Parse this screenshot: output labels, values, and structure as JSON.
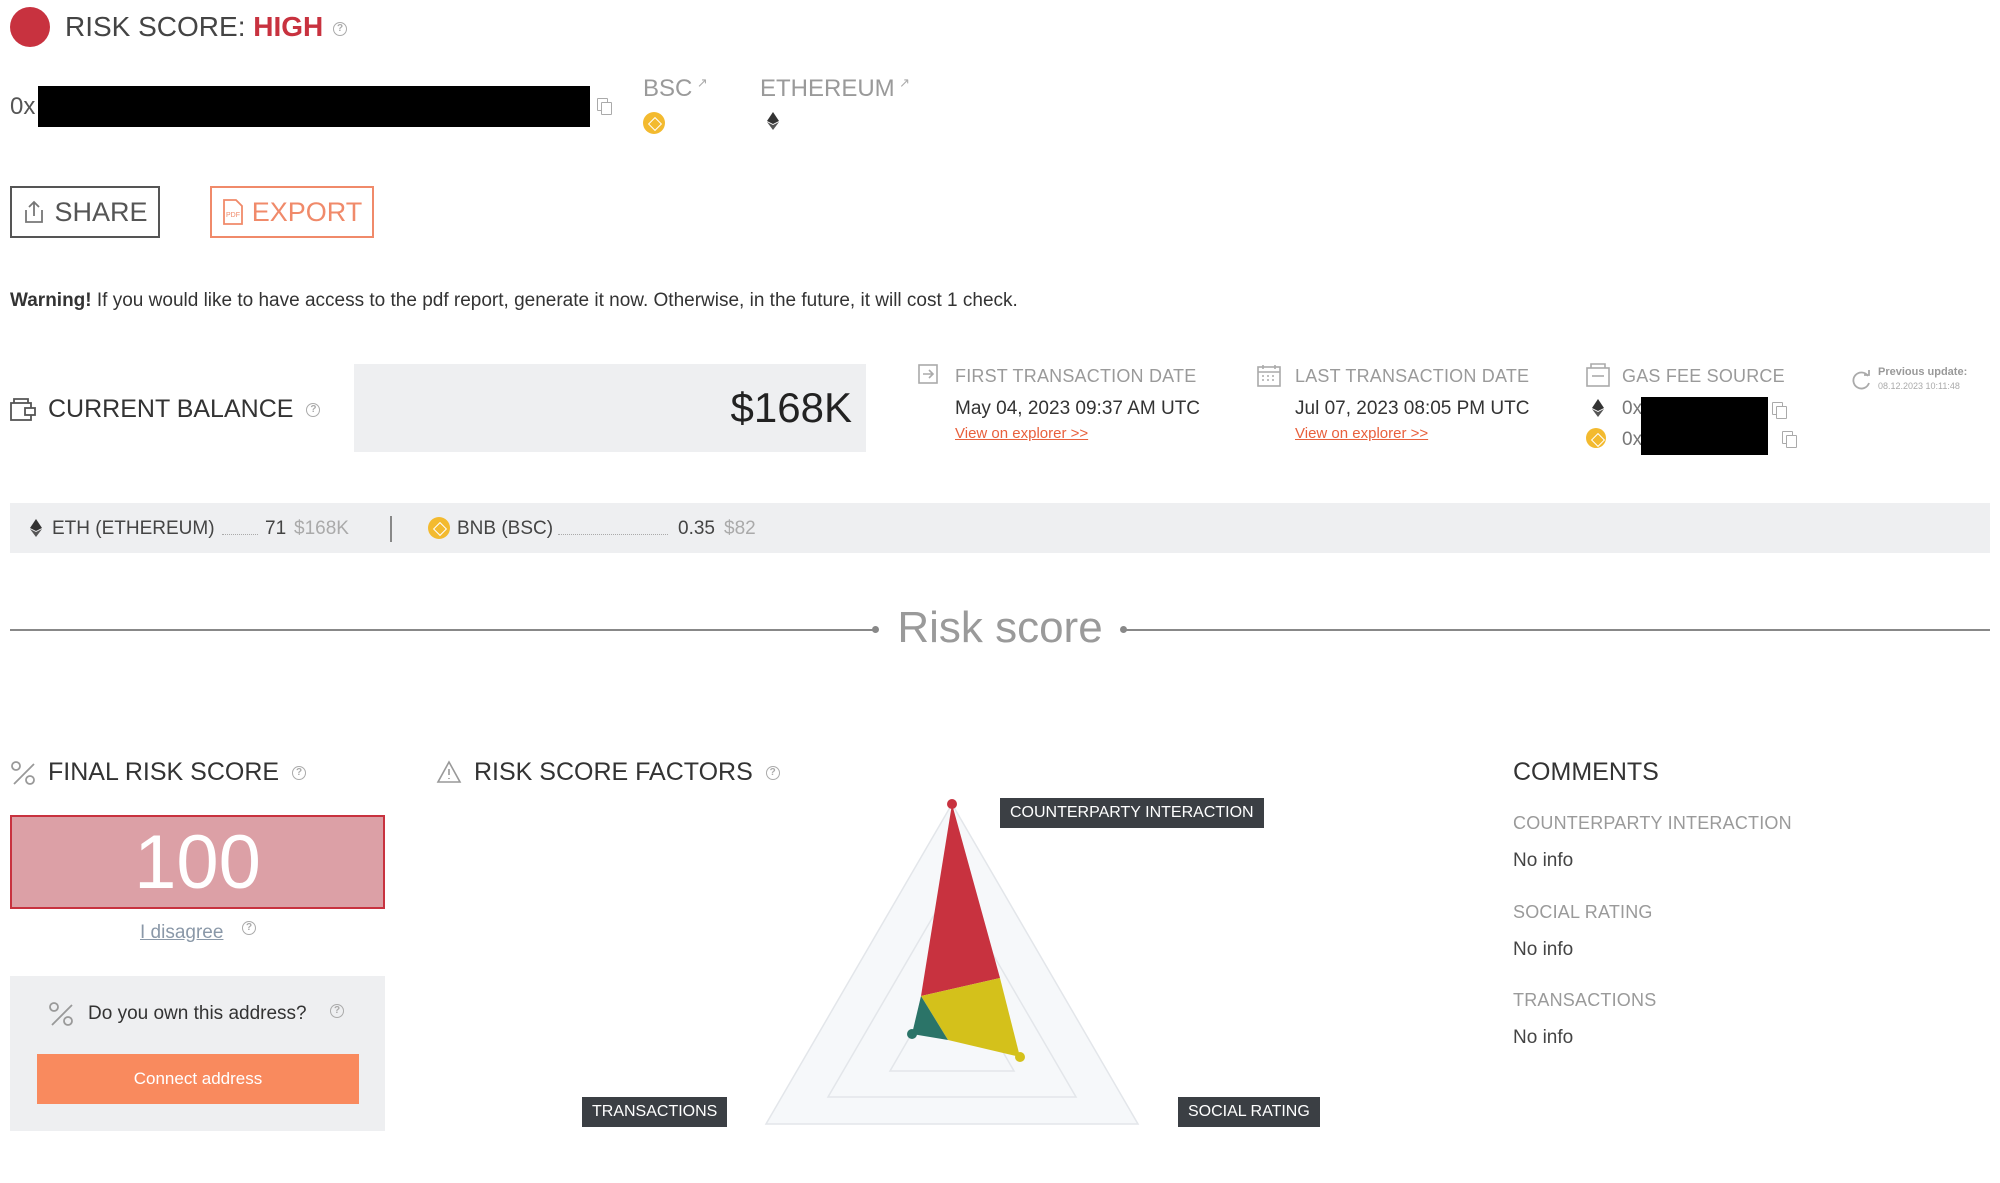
{
  "header": {
    "risk_label": "RISK SCORE:",
    "risk_level": "HIGH",
    "address_prefix": "0x",
    "networks": [
      {
        "label": "BSC",
        "icon": "bnb-coin-icon"
      },
      {
        "label": "ETHEREUM",
        "icon": "ethereum-icon"
      }
    ]
  },
  "actions": {
    "share_label": "SHARE",
    "export_label": "EXPORT"
  },
  "warning": {
    "bold": "Warning!",
    "text": " If you would like to have access to the pdf report, generate it now. Otherwise, in the future, it will cost 1 check."
  },
  "balance": {
    "label": "CURRENT BALANCE",
    "value": "$168K"
  },
  "first_tx": {
    "label": "FIRST TRANSACTION DATE",
    "value": "May 04, 2023 09:37 AM UTC",
    "link": "View on explorer >>"
  },
  "last_tx": {
    "label": "LAST TRANSACTION DATE",
    "value": "Jul 07, 2023 08:05 PM UTC",
    "link": "View on explorer >>"
  },
  "gas_fee": {
    "label": "GAS FEE SOURCE",
    "rows": [
      {
        "prefix": "0x",
        "icon": "ethereum-icon"
      },
      {
        "prefix": "0x",
        "icon": "bnb-coin-icon"
      }
    ]
  },
  "previous_update": {
    "label": "Previous update:",
    "value": "08.12.2023 10:11:48"
  },
  "holdings": [
    {
      "name": "ETH (ETHEREUM)",
      "amount": "71",
      "usd": "$168K",
      "icon": "ethereum-icon"
    },
    {
      "name": "BNB (BSC)",
      "amount": "0.35",
      "usd": "$82",
      "icon": "bnb-coin-icon"
    }
  ],
  "section_title": "Risk score",
  "final_score": {
    "label": "FINAL RISK SCORE",
    "value": "100",
    "disagree": "I disagree"
  },
  "own_address": {
    "question": "Do you own this address?",
    "button": "Connect address"
  },
  "factors": {
    "label": "RISK SCORE FACTORS",
    "axes": [
      "COUNTERPARTY INTERACTION",
      "SOCIAL RATING",
      "TRANSACTIONS"
    ]
  },
  "comments": {
    "label": "COMMENTS",
    "items": [
      {
        "title": "COUNTERPARTY INTERACTION",
        "text": "No info"
      },
      {
        "title": "SOCIAL RATING",
        "text": "No info"
      },
      {
        "title": "TRANSACTIONS",
        "text": "No info"
      }
    ]
  },
  "colors": {
    "accent": "#e8603c",
    "high": "#c8323f",
    "score_bg": "#dca0a6",
    "radar_red": "#c8323f",
    "radar_yellow": "#d4c11b",
    "radar_teal": "#2b7468"
  }
}
